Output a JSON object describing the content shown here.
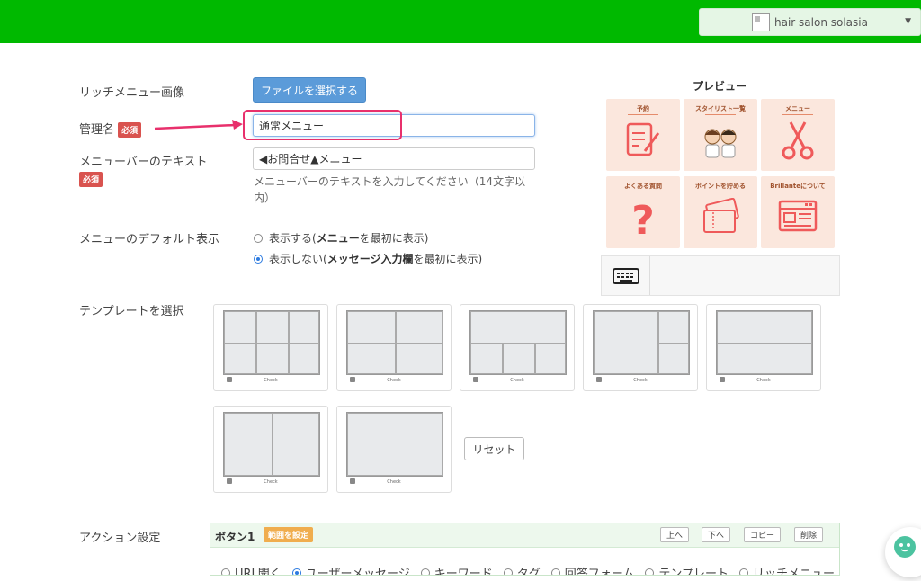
{
  "header": {
    "salon_name": "hair salon solasia"
  },
  "form": {
    "rich_menu_image_label": "リッチメニュー画像",
    "file_select_button": "ファイルを選択する",
    "admin_name_label": "管理名",
    "required_badge": "必須",
    "admin_name_value": "通常メニュー",
    "menubar_text_label": "メニューバーのテキスト",
    "menubar_text_value": "◀お問合せ▲メニュー",
    "menubar_help": "メニューバーのテキストを入力してください（14文字以内）",
    "default_display_label": "メニューのデフォルト表示",
    "option_show_prefix": "表示する(",
    "option_show_bold": "メニュー",
    "option_show_suffix": "を最初に表示)",
    "option_hide_prefix": "表示しない(",
    "option_hide_bold": "メッセージ入力欄",
    "option_hide_suffix": "を最初に表示)",
    "template_label": "テンプレートを選択",
    "template_check": "Check",
    "reset_button": "リセット",
    "action_label": "アクション設定"
  },
  "preview": {
    "title": "プレビュー",
    "tiles": [
      "予約",
      "スタイリスト一覧",
      "メニュー",
      "よくある質問",
      "ポイントを貯める",
      "Brillanteについて"
    ]
  },
  "action": {
    "button_title": "ボタン1",
    "range_button": "範囲を設定",
    "up": "上へ",
    "down": "下へ",
    "copy": "コピー",
    "delete": "削除",
    "options": [
      "URL開く",
      "ユーザーメッセージ",
      "キーワード",
      "タグ",
      "回答フォーム",
      "テンプレート",
      "リッチメニュー"
    ],
    "selected_option": "ユーザーメッセージ"
  },
  "colors": {
    "header": "#00b900",
    "accent_pink": "#e8306c",
    "file_button": "#5b9bd9",
    "required": "#d9534f",
    "tile_bg": "#fbe7dd",
    "tile_icon": "#ef5a5a"
  }
}
